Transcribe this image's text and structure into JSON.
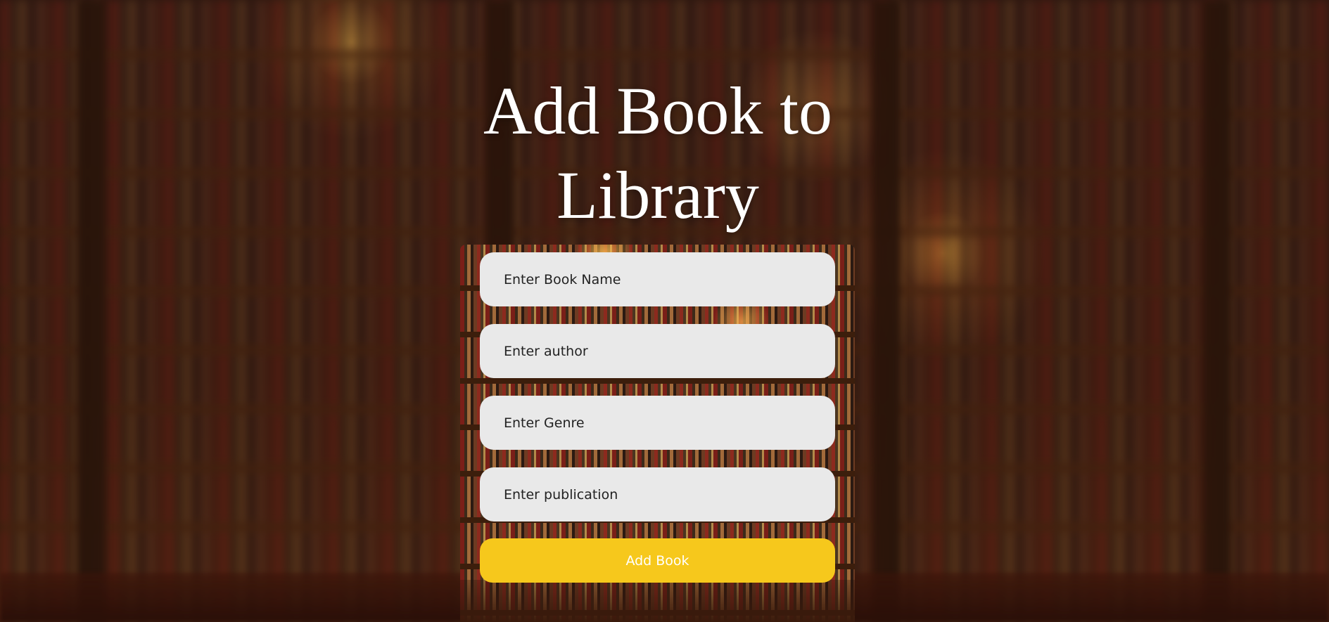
{
  "page": {
    "title_line1": "Add Book to",
    "title_line2": "Library"
  },
  "form": {
    "book_name": {
      "placeholder": "Enter Book Name",
      "value": ""
    },
    "author": {
      "placeholder": "Enter author",
      "value": ""
    },
    "genre": {
      "placeholder": "Enter Genre",
      "value": ""
    },
    "publication": {
      "placeholder": "Enter publication",
      "value": ""
    },
    "submit_label": "Add Book"
  },
  "colors": {
    "button": "#f6c81c",
    "input_bg": "#e9e9e9",
    "title": "#ffffff"
  }
}
